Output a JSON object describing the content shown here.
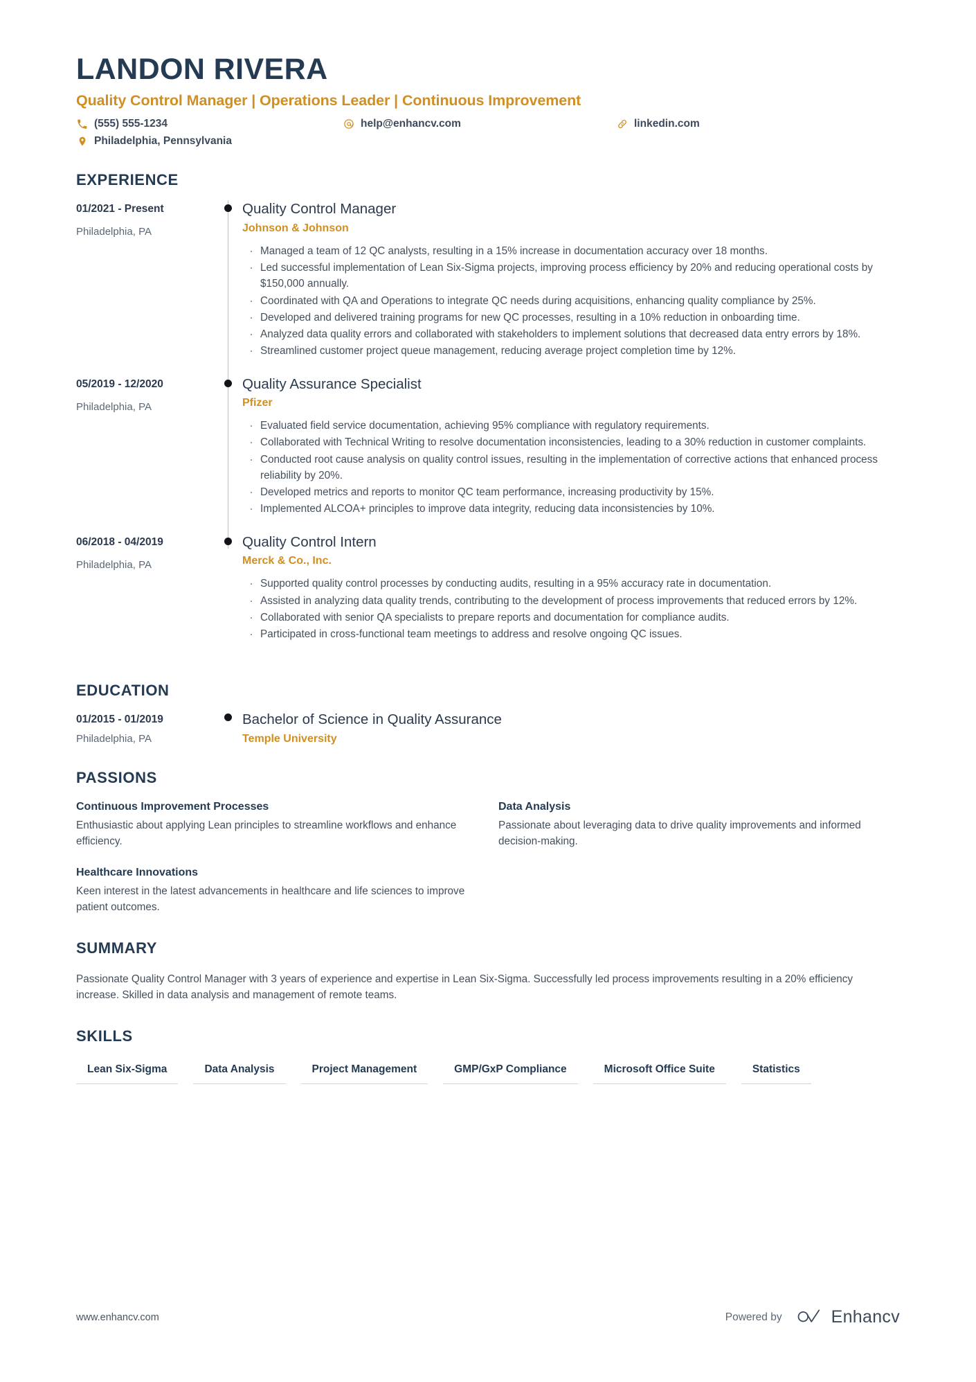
{
  "header": {
    "full_name": "LANDON RIVERA",
    "headline": "Quality Control Manager | Operations Leader | Continuous Improvement",
    "accent_color": "#d18f22",
    "text_color": "#243b53",
    "contacts": [
      {
        "icon": "phone-icon",
        "value": "(555) 555-1234"
      },
      {
        "icon": "email-icon",
        "value": "help@enhancv.com"
      },
      {
        "icon": "link-icon",
        "value": "linkedin.com"
      },
      {
        "icon": "location-pin-icon",
        "value": "Philadelphia, Pennsylvania"
      }
    ]
  },
  "experience": {
    "title": "EXPERIENCE",
    "entries": [
      {
        "date": "01/2021 - Present",
        "location": "Philadelphia, PA",
        "job_title": "Quality Control Manager",
        "company": "Johnson & Johnson",
        "bullets": [
          "Managed a team of 12 QC analysts, resulting in a 15% increase in documentation accuracy over 18 months.",
          "Led successful implementation of Lean Six-Sigma projects, improving process efficiency by 20% and reducing operational costs by $150,000 annually.",
          "Coordinated with QA and Operations to integrate QC needs during acquisitions, enhancing quality compliance by 25%.",
          "Developed and delivered training programs for new QC processes, resulting in a 10% reduction in onboarding time.",
          "Analyzed data quality errors and collaborated with stakeholders to implement solutions that decreased data entry errors by 18%.",
          "Streamlined customer project queue management, reducing average project completion time by 12%."
        ]
      },
      {
        "date": "05/2019 - 12/2020",
        "location": "Philadelphia, PA",
        "job_title": "Quality Assurance Specialist",
        "company": "Pfizer",
        "bullets": [
          "Evaluated field service documentation, achieving 95% compliance with regulatory requirements.",
          "Collaborated with Technical Writing to resolve documentation inconsistencies, leading to a 30% reduction in customer complaints.",
          "Conducted root cause analysis on quality control issues, resulting in the implementation of corrective actions that enhanced process reliability by 20%.",
          "Developed metrics and reports to monitor QC team performance, increasing productivity by 15%.",
          "Implemented ALCOA+ principles to improve data integrity, reducing data inconsistencies by 10%."
        ]
      },
      {
        "date": "06/2018 - 04/2019",
        "location": "Philadelphia, PA",
        "job_title": "Quality Control Intern",
        "company": "Merck & Co., Inc.",
        "bullets": [
          "Supported quality control processes by conducting audits, resulting in a 95% accuracy rate in documentation.",
          "Assisted in analyzing data quality trends, contributing to the development of process improvements that reduced errors by 12%.",
          "Collaborated with senior QA specialists to prepare reports and documentation for compliance audits.",
          "Participated in cross-functional team meetings to address and resolve ongoing QC issues."
        ]
      }
    ]
  },
  "education": {
    "title": "EDUCATION",
    "entries": [
      {
        "date": "01/2015 - 01/2019",
        "location": "Philadelphia, PA",
        "degree": "Bachelor of Science in Quality Assurance",
        "school": "Temple University"
      }
    ]
  },
  "passions": {
    "title": "PASSIONS",
    "items": [
      {
        "name": "Continuous Improvement Processes",
        "text": "Enthusiastic about applying Lean principles to streamline workflows and enhance efficiency."
      },
      {
        "name": "Data Analysis",
        "text": "Passionate about leveraging data to drive quality improvements and informed decision-making."
      },
      {
        "name": "Healthcare Innovations",
        "text": "Keen interest in the latest advancements in healthcare and life sciences to improve patient outcomes."
      }
    ]
  },
  "summary": {
    "title": "SUMMARY",
    "text": "Passionate Quality Control Manager with 3 years of experience and expertise in Lean Six-Sigma. Successfully led process improvements resulting in a 20% efficiency increase. Skilled in data analysis and management of remote teams."
  },
  "skills": {
    "title": "SKILLS",
    "items": [
      "Lean Six-Sigma",
      "Data Analysis",
      "Project Management",
      "GMP/GxP Compliance",
      "Microsoft Office Suite",
      "Statistics"
    ]
  },
  "footer": {
    "url": "www.enhancv.com",
    "powered_by": "Powered by",
    "brand_name": "Enhancv"
  }
}
